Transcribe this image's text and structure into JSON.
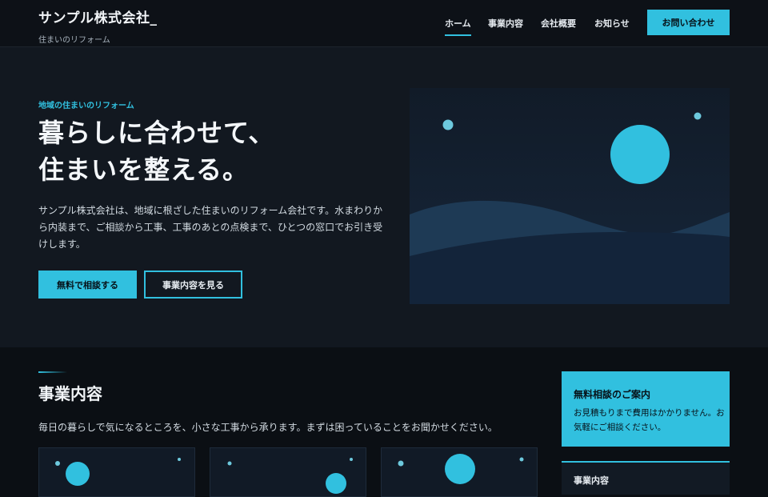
{
  "header": {
    "logo_title": "サンプル株式会社_",
    "logo_subtitle": "住まいのリフォーム",
    "nav": [
      {
        "label": "ホーム",
        "active": true
      },
      {
        "label": "事業内容",
        "active": false
      },
      {
        "label": "会社概要",
        "active": false
      },
      {
        "label": "お知らせ",
        "active": false
      }
    ],
    "cta_label": "お問い合わせ"
  },
  "hero": {
    "eyebrow": "地域の住まいのリフォーム",
    "headline_line1": "暮らしに合わせて、",
    "headline_line2": "住まいを整える。",
    "lead": "サンプル株式会社は、地域に根ざした住まいのリフォーム会社です。水まわりから内装まで、ご相談から工事、工事のあとの点検まで、ひとつの窓口でお引き受けします。",
    "primary_button": "無料で相談する",
    "secondary_button": "事業内容を見る"
  },
  "services": {
    "title": "事業内容",
    "lead": "毎日の暮らしで気になるところを、小さな工事から承ります。まずは困っていることをお聞かせください。"
  },
  "sidebar": {
    "consult_title": "無料相談のご案内",
    "consult_text": "お見積もりまで費用はかかりません。お気軽にご相談ください。",
    "services_title": "事業内容"
  },
  "colors": {
    "accent": "#31c0df",
    "background": "#0b0f14",
    "hero_background": "#121820",
    "panel": "#111a26"
  }
}
